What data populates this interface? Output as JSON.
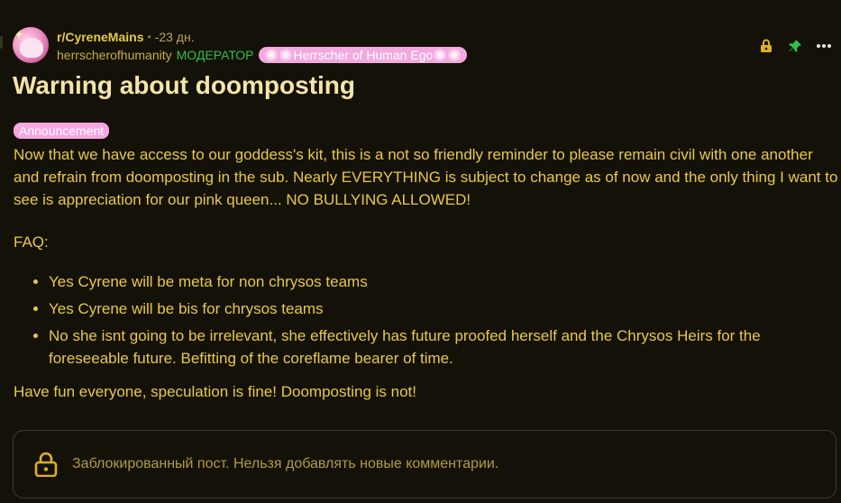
{
  "post": {
    "subreddit": "r/CyreneMains",
    "separator": "•",
    "time": "-23 дн.",
    "author": "herrscherofhumanity",
    "author_role": "МОДЕРАТОР",
    "user_flair": "Herrscher of Human Ego",
    "title": "Warning about doomposting",
    "post_flair": "Announcement",
    "paragraph1": "Now that we have access to our goddess's kit, this is a not so friendly reminder to please remain civil with one another and refrain from doomposting in the sub. Nearly EVERYTHING is subject to change as of now and the only thing I want to see is appreciation for our pink queen... NO BULLYING ALLOWED!",
    "faq_label": "FAQ:",
    "faq_items": [
      "Yes Cyrene will be meta for non chrysos teams",
      "Yes Cyrene will be bis for chrysos teams",
      "No she isnt going to be irrelevant, she effectively has future proofed herself and the Chrysos Heirs for the foreseeable future. Befitting of the coreflame bearer of time."
    ],
    "closing": "Have fun everyone, speculation is fine! Doomposting is not!"
  },
  "actions": {
    "icons": [
      "lock-icon",
      "pin-icon",
      "more-options-icon"
    ]
  },
  "locked_notice": {
    "icon": "lock-icon",
    "text": "Заблокированный пост. Нельзя добавлять новые комментарии."
  },
  "colors": {
    "background": "#141208",
    "text": "#e8c84a",
    "title": "#f4e5a8",
    "moderator": "#2fbf4a",
    "flair": "#f3a8e0",
    "lock_icon": "#e0b020",
    "pin_icon": "#2fbf4a"
  }
}
